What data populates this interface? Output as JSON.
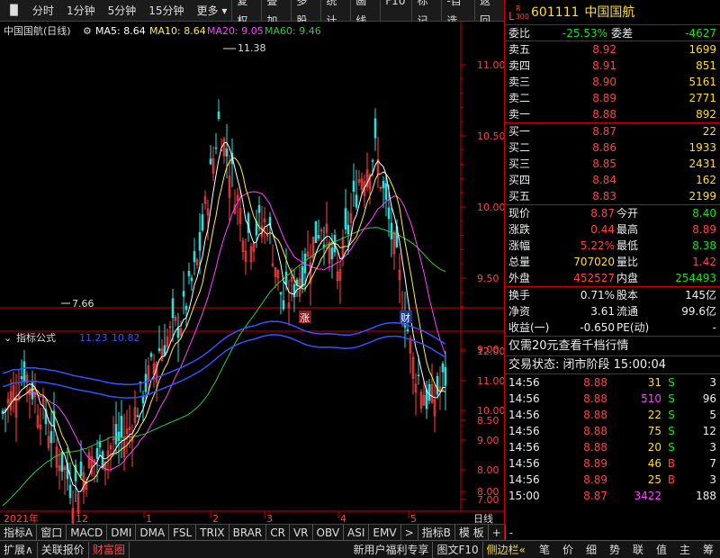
{
  "toolbar": {
    "left": [
      "分时",
      "1分钟",
      "5分钟",
      "15分钟",
      "更多"
    ],
    "right": [
      "复权",
      "叠加",
      "多股",
      "统计",
      "画线",
      "F10",
      "标记",
      "-自选",
      "返回"
    ]
  },
  "chart": {
    "title": "中国国航(日线)",
    "ma5": "MA5: 8.64",
    "ma10": "MA10: 8.64",
    "ma20": "MA20: 9.05",
    "ma60": "MA60: 9.46",
    "high_label": "11.38",
    "low_label": "7.66",
    "price_ticks": [
      "11.00",
      "10.50",
      "10.00",
      "9.50",
      "9.00",
      "8.50",
      "8.00",
      "7.50"
    ],
    "markers": [
      "涨",
      "财"
    ],
    "indicator_title": "指标公式",
    "indicator_v1": "11.23",
    "indicator_v2": "10.82",
    "ind_ticks": [
      "12.00",
      "11.00",
      "10.00",
      "9.00",
      "8.00",
      "7.00"
    ],
    "date_labels": [
      "2021年",
      "12",
      "1",
      "2",
      "3",
      "4",
      "5"
    ],
    "period": "日线"
  },
  "tabs": [
    "指标A",
    "窗口",
    "MACD",
    "DMI",
    "DMA",
    "FSL",
    "TRIX",
    "BRAR",
    "CR",
    "VR",
    "OBV",
    "ASI",
    "EMV",
    ">",
    "指标B",
    "模 板",
    "+",
    "-"
  ],
  "bottom": {
    "left": [
      "扩展∧",
      "关联报价",
      "财富圈"
    ],
    "mid": [
      "新用户福利专享",
      "图文F10",
      "侧边栏«"
    ],
    "right": [
      "笔",
      "价",
      "细",
      "势",
      "联",
      "值",
      "主",
      "筹"
    ]
  },
  "stock": {
    "badge_top": "R",
    "badge_l": "L",
    "badge_num": "300",
    "code": "601111",
    "name": "中国国航"
  },
  "ratio": {
    "label1": "委比",
    "v1": "-25.53%",
    "label2": "委差",
    "v2": "-4627"
  },
  "asks": [
    {
      "l": "卖五",
      "p": "8.92",
      "v": "1699"
    },
    {
      "l": "卖四",
      "p": "8.91",
      "v": "851"
    },
    {
      "l": "卖三",
      "p": "8.90",
      "v": "5161"
    },
    {
      "l": "卖二",
      "p": "8.89",
      "v": "2771"
    },
    {
      "l": "卖一",
      "p": "8.88",
      "v": "892"
    }
  ],
  "bids": [
    {
      "l": "买一",
      "p": "8.87",
      "v": "22"
    },
    {
      "l": "买二",
      "p": "8.86",
      "v": "1933"
    },
    {
      "l": "买三",
      "p": "8.85",
      "v": "2431"
    },
    {
      "l": "买四",
      "p": "8.84",
      "v": "162"
    },
    {
      "l": "买五",
      "p": "8.83",
      "v": "2199"
    }
  ],
  "quote": [
    {
      "a": "现价",
      "b": "8.87",
      "c": "今开",
      "d": "8.40",
      "bc": "red",
      "dc": "grn"
    },
    {
      "a": "涨跌",
      "b": "0.44",
      "c": "最高",
      "d": "8.89",
      "bc": "red",
      "dc": "red"
    },
    {
      "a": "涨幅",
      "b": "5.22%",
      "c": "最低",
      "d": "8.38",
      "bc": "red",
      "dc": "grn"
    },
    {
      "a": "总量",
      "b": "707020",
      "c": "量比",
      "d": "1.42",
      "bc": "yel",
      "dc": "red"
    },
    {
      "a": "外盘",
      "b": "452527",
      "c": "内盘",
      "d": "254493",
      "bc": "red",
      "dc": "grn"
    }
  ],
  "quote2": [
    {
      "a": "换手",
      "b": "0.71%",
      "c": "股本",
      "d": "145亿"
    },
    {
      "a": "净资",
      "b": "3.61",
      "c": "流通",
      "d": "99.6亿"
    },
    {
      "a": "收益(一)",
      "b": "-0.650",
      "c": "PE(动)",
      "d": "-"
    }
  ],
  "promo": "仅需20元查看千档行情",
  "status": "交易状态: 闭市阶段 15:00:04",
  "trades": [
    {
      "t": "14:56",
      "p": "8.88",
      "v": "31",
      "f": "S",
      "n": "3",
      "vc": "yel"
    },
    {
      "t": "14:56",
      "p": "8.88",
      "v": "510",
      "f": "S",
      "n": "96",
      "vc": "mag"
    },
    {
      "t": "14:56",
      "p": "8.88",
      "v": "22",
      "f": "S",
      "n": "5",
      "vc": "yel"
    },
    {
      "t": "14:56",
      "p": "8.88",
      "v": "75",
      "f": "S",
      "n": "12",
      "vc": "yel"
    },
    {
      "t": "14:56",
      "p": "8.88",
      "v": "20",
      "f": "S",
      "n": "3",
      "vc": "yel"
    },
    {
      "t": "14:56",
      "p": "8.89",
      "v": "46",
      "f": "B",
      "n": "7",
      "vc": "yel"
    },
    {
      "t": "14:56",
      "p": "8.89",
      "v": "25",
      "f": "B",
      "n": "3",
      "vc": "yel"
    },
    {
      "t": "15:00",
      "p": "8.87",
      "v": "3422",
      "f": "",
      "n": "188",
      "vc": "mag"
    }
  ]
}
